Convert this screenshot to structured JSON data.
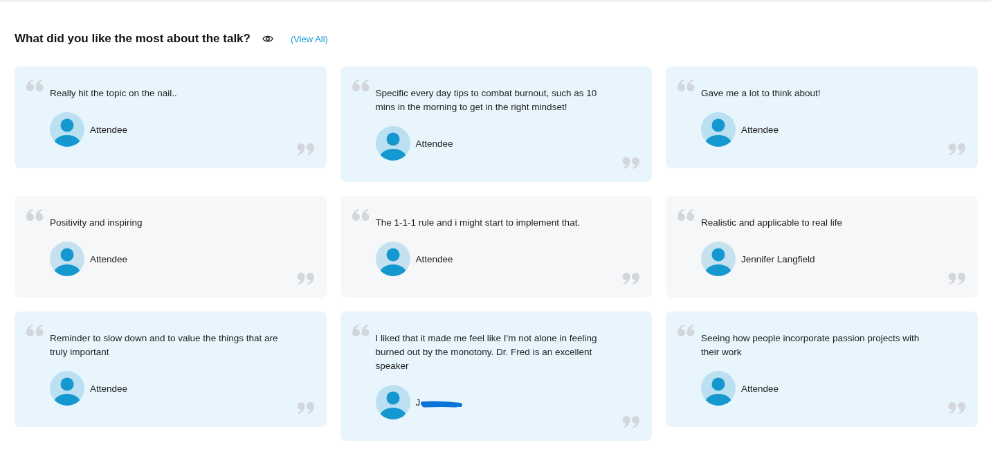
{
  "section": {
    "title": "What did you like the most about the talk?",
    "link": "(View All)"
  },
  "cards": [
    {
      "quote": "Really hit the topic on the nail..",
      "name": "Attendee",
      "color": "#e8f5fc",
      "redacted": false
    },
    {
      "quote": "Specific every day tips to combat burnout, such as 10 mins in the morning to get in the right mindset!",
      "name": "Attendee",
      "color": "#e8f5fc",
      "redacted": false
    },
    {
      "quote": "Gave me a lot to think about!",
      "name": "Attendee",
      "color": "#e8f5fc",
      "redacted": false
    },
    {
      "quote": "Positivity and inspiring",
      "name": "Attendee",
      "color": "#f6f7f9",
      "redacted": false
    },
    {
      "quote": "The 1-1-1 rule and i might start to implement that.",
      "name": "Attendee",
      "color": "#f6f7f9",
      "redacted": false
    },
    {
      "quote": "Realistic and applicable to real life",
      "name": "Jennifer Langfield",
      "color": "#f6f7f9",
      "redacted": false
    },
    {
      "quote": "Reminder to slow down and to value the things that are truly important",
      "name": "Attendee",
      "color": "#e8f5fc",
      "redacted": false
    },
    {
      "quote": "I liked that it made me feel like I'm not alone in feeling burned out by the monotony. Dr. Fred is an excellent speaker",
      "name": "J",
      "color": "#e8f5fc",
      "redacted": true
    },
    {
      "quote": "Seeing how people incorporate passion projects with their work",
      "name": "Attendee",
      "color": "#e8f5fc",
      "redacted": false
    }
  ]
}
